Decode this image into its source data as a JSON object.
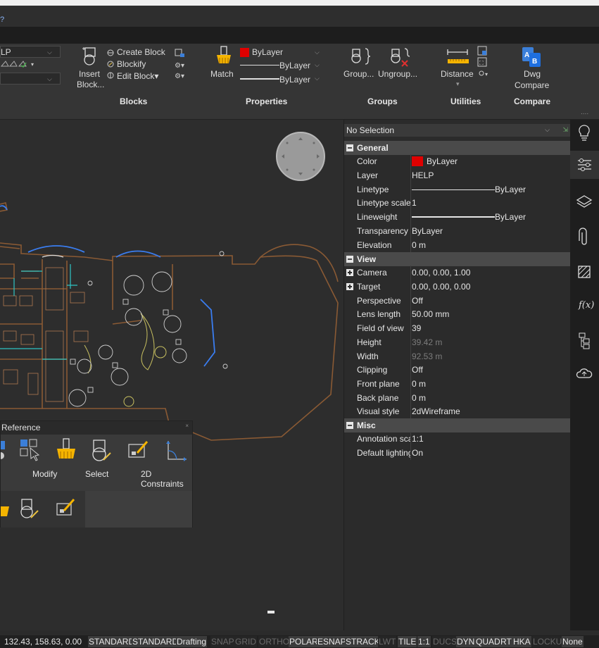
{
  "titlebar": {
    "help_glyph": "?"
  },
  "ribbon": {
    "layer": {
      "current": "LP"
    },
    "blocks": {
      "insert_label_1": "Insert",
      "insert_label_2": "Block...",
      "create_block": "Create Block",
      "blockify": "Blockify",
      "edit_block": "Edit Block▾",
      "panel_label": "Blocks"
    },
    "properties": {
      "match_label": "Match",
      "color_value": "ByLayer",
      "linetype_value": "ByLayer",
      "lineweight_value": "ByLayer",
      "panel_label": "Properties",
      "accent_color": "#e00000"
    },
    "groups": {
      "group_label": "Group...",
      "ungroup_label": "Ungroup...",
      "panel_label": "Groups"
    },
    "utilities": {
      "distance_label": "Distance",
      "panel_label": "Utilities"
    },
    "compare": {
      "dwg_label_1": "Dwg",
      "dwg_label_2": "Compare",
      "panel_label": "Compare"
    }
  },
  "quad": {
    "title": "Reference",
    "close_glyph": "×",
    "labels": {
      "modify": "Modify",
      "select": "Select",
      "constraints_1": "2D",
      "constraints_2": "Constraints"
    }
  },
  "properties_panel": {
    "selection": "No Selection",
    "sections": {
      "general": "General",
      "view": "View",
      "misc": "Misc"
    },
    "general": [
      {
        "key": "Color",
        "value": "ByLayer"
      },
      {
        "key": "Layer",
        "value": "HELP"
      },
      {
        "key": "Linetype",
        "value": "ByLayer"
      },
      {
        "key": "Linetype scale",
        "value": "1"
      },
      {
        "key": "Lineweight",
        "value": "ByLayer"
      },
      {
        "key": "Transparency",
        "value": "ByLayer"
      },
      {
        "key": "Elevation",
        "value": "0 m"
      }
    ],
    "view": [
      {
        "key": "Camera",
        "value": "0.00, 0.00, 1.00"
      },
      {
        "key": "Target",
        "value": "0.00, 0.00, 0.00"
      },
      {
        "key": "Perspective",
        "value": "Off"
      },
      {
        "key": "Lens length",
        "value": "50.00 mm"
      },
      {
        "key": "Field of view",
        "value": "39"
      },
      {
        "key": "Height",
        "value": "39.42 m"
      },
      {
        "key": "Width",
        "value": "92.53 m"
      },
      {
        "key": "Clipping",
        "value": "Off"
      },
      {
        "key": "Front plane",
        "value": "0 m"
      },
      {
        "key": "Back plane",
        "value": "0 m"
      },
      {
        "key": "Visual style",
        "value": "2dWireframe"
      }
    ],
    "misc": [
      {
        "key": "Annotation scale",
        "value": "1:1"
      },
      {
        "key": "Default lighting",
        "value": "On"
      }
    ]
  },
  "right_toolbar": {
    "more_glyph": "....",
    "icons": [
      "lightbulb-icon",
      "sliders-icon",
      "layers-icon",
      "paperclip-icon",
      "hatch-icon",
      "fx-icon",
      "tree-icon",
      "cloud-icon"
    ],
    "fx_label": "f(x)"
  },
  "status_bar": {
    "coordinates": "132.43, 158.63, 0.00",
    "buttons": [
      {
        "label": "STANDARD",
        "on": true
      },
      {
        "label": "STANDARD",
        "on": true
      },
      {
        "label": "Drafting",
        "on": true
      },
      {
        "label": "SNAP",
        "on": false
      },
      {
        "label": "GRID",
        "on": false
      },
      {
        "label": "ORTHO",
        "on": false
      },
      {
        "label": "POLAR",
        "on": true
      },
      {
        "label": "ESNAP",
        "on": true
      },
      {
        "label": "STRACK",
        "on": true
      },
      {
        "label": "LWT",
        "on": false
      },
      {
        "label": "TILE",
        "on": true
      },
      {
        "label": "1:1",
        "on": true
      },
      {
        "label": "DUCS",
        "on": false
      },
      {
        "label": "DYN",
        "on": true
      },
      {
        "label": "QUAD",
        "on": true
      },
      {
        "label": "RT",
        "on": true
      },
      {
        "label": "HKA",
        "on": true
      },
      {
        "label": "LOCKUI",
        "on": false
      },
      {
        "label": "None",
        "on": true
      }
    ]
  }
}
